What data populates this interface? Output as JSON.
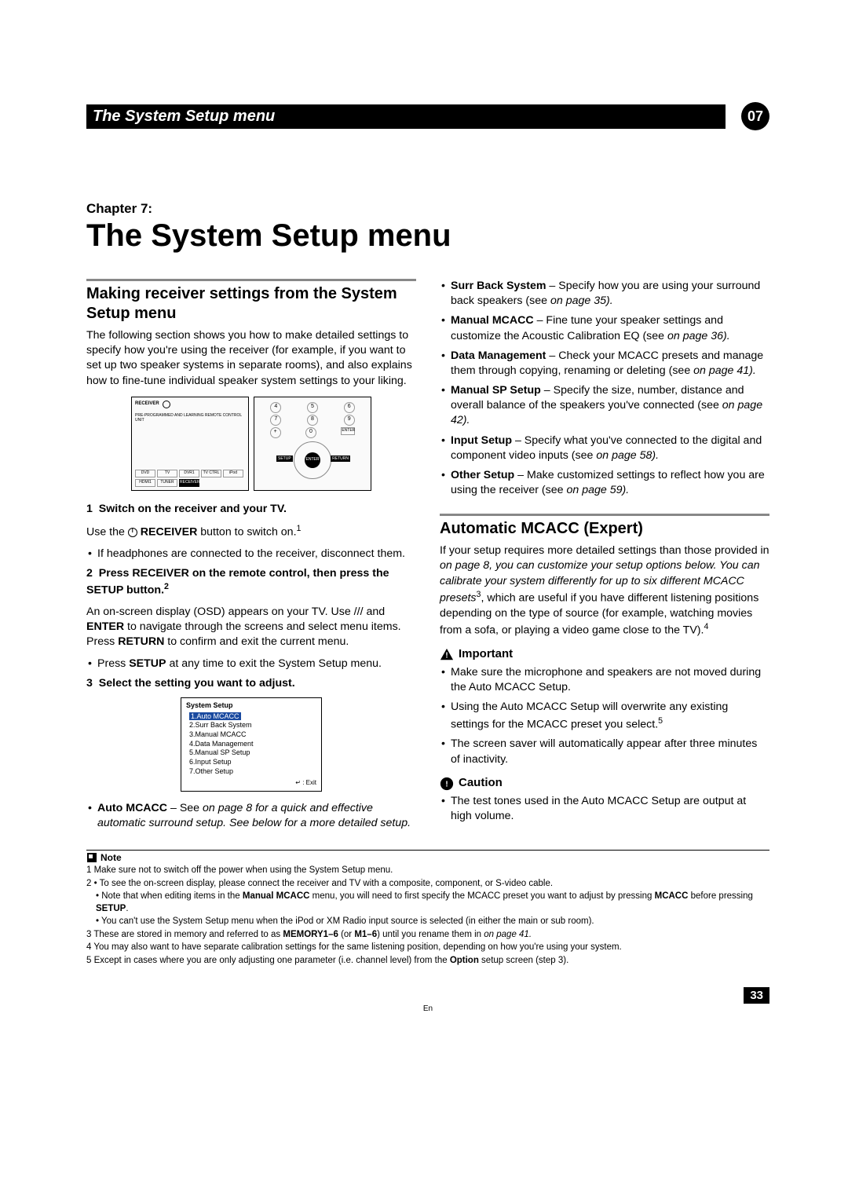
{
  "header": {
    "title": "The System Setup menu",
    "page_badge": "07"
  },
  "chapter_label": "Chapter 7:",
  "main_title": "The System Setup menu",
  "s1": {
    "heading": "Making receiver settings from the System Setup menu",
    "p1": "The following section shows you how to make detailed settings to specify how you're using the receiver (for example, if you want to set up two speaker systems in separate rooms), and also explains how to fine-tune individual speaker system settings to your liking.",
    "step1_num": "1",
    "step1_title": "Switch on the receiver and your TV.",
    "step1_line": "Use the ",
    "step1_line_b": " RECEIVER",
    "step1_line_c": " button to switch on.",
    "step1_bullet": "If headphones are connected to the receiver, disconnect them.",
    "step2_num": "2",
    "step2_title_a": "Press RECEIVER on the remote control, then press the SETUP button.",
    "step2_p_a": "An on-screen display (OSD) appears on your TV. Use ",
    "step2_p_b": " and ",
    "step2_p_enter": "ENTER",
    "step2_p_c": " to navigate through the screens and select menu items. Press ",
    "step2_p_return": "RETURN",
    "step2_p_d": " to confirm and exit the current menu.",
    "step2_bullet_a": "Press ",
    "step2_bullet_setup": "SETUP",
    "step2_bullet_b": " at any time to exit the System Setup menu.",
    "step3_num": "3",
    "step3_title": "Select the setting you want to adjust.",
    "osd": {
      "title": "System  Setup",
      "items": [
        "1.Auto  MCACC",
        "2.Surr  Back  System",
        "3.Manual  MCACC",
        "4.Data  Management",
        "5.Manual  SP  Setup",
        "6.Input  Setup",
        "7.Other  Setup"
      ],
      "exit": ": Exit"
    },
    "auto_mcacc_label": "Auto MCACC",
    "auto_mcacc_a": " – See ",
    "auto_mcacc_b": " on page 8 for a quick and effective automatic surround setup. See ",
    "auto_mcacc_c": " below for a more detailed setup."
  },
  "s2_items": [
    {
      "label": "Surr Back System",
      "a": " – Specify how you are using your surround back speakers (see ",
      "b": " on page 35)."
    },
    {
      "label": "Manual MCACC",
      "a": " – Fine tune your speaker settings and customize the Acoustic Calibration EQ (see ",
      "b": " on page 36)."
    },
    {
      "label": "Data Management",
      "a": " – Check your MCACC presets and manage them through copying, renaming or deleting (see ",
      "b": " on page 41)."
    },
    {
      "label": "Manual SP Setup",
      "a": " – Specify the size, number, distance and overall balance of the speakers you've connected (see ",
      "b": " on page 42)."
    },
    {
      "label": "Input Setup",
      "a": " – Specify what you've connected to the digital and component video inputs (see ",
      "b": " on page 58)."
    },
    {
      "label": "Other Setup",
      "a": " – Make customized settings to reflect how you are using the receiver (see ",
      "b": " on page 59)."
    }
  ],
  "s3": {
    "heading": "Automatic MCACC (Expert)",
    "p1_a": "If your setup requires more detailed settings than those provided in ",
    "p1_b": " on page 8, you can customize your setup options below. You can calibrate your system differently for up to six different MCACC presets",
    "p1_c": ", which are useful if you have different listening positions depending on the type of source (for example, watching movies from a sofa, or playing a video game close to the TV).",
    "important_label": "Important",
    "imp1": "Make sure the microphone and speakers are not moved during the Auto MCACC Setup.",
    "imp2": "Using the Auto MCACC Setup will overwrite any existing settings for the MCACC preset you select.",
    "imp3": "The screen saver will automatically appear after three minutes of inactivity.",
    "caution_label": "Caution",
    "caution1": "The test tones used in the Auto MCACC Setup are output at high volume."
  },
  "footnotes": {
    "note_label": "Note",
    "f1": "1  Make sure not to switch off the power when using the System Setup menu.",
    "f2a": "2  • To see the on-screen display, please connect the receiver and TV with a composite, component, or S-video cable.",
    "f2b_a": "• Note that when editing items in the ",
    "f2b_bold1": "Manual MCACC",
    "f2b_b": " menu, you will need to first specify the MCACC preset you want to adjust by pressing ",
    "f2b_bold2": "MCACC",
    "f2b_c": " before pressing ",
    "f2b_bold3": "SETUP",
    "f2b_d": ".",
    "f2c": "• You can't use the System Setup menu when the iPod or XM Radio input source is selected (in either the main or sub room).",
    "f3_a": "3  These are stored in memory and referred to as ",
    "f3_bold1": "MEMORY1–6",
    "f3_b": " (or ",
    "f3_bold2": "M1–6",
    "f3_c": ") until you rename them in ",
    "f3_d": " on page 41.",
    "f4": "4  You may also want to have separate calibration settings for the same listening position, depending on how you're using your system.",
    "f5_a": "5  Except in cases where you are only adjusting one parameter (i.e. channel level) from the ",
    "f5_bold": "Option",
    "f5_b": " setup screen (step 3)."
  },
  "footer": {
    "page_num": "33",
    "lang": "En"
  },
  "remote": {
    "receiver": "RECEIVER",
    "sub": "PRE-PROGRAMMED AND LEARNING REMOTE CONTROL UNIT"
  }
}
